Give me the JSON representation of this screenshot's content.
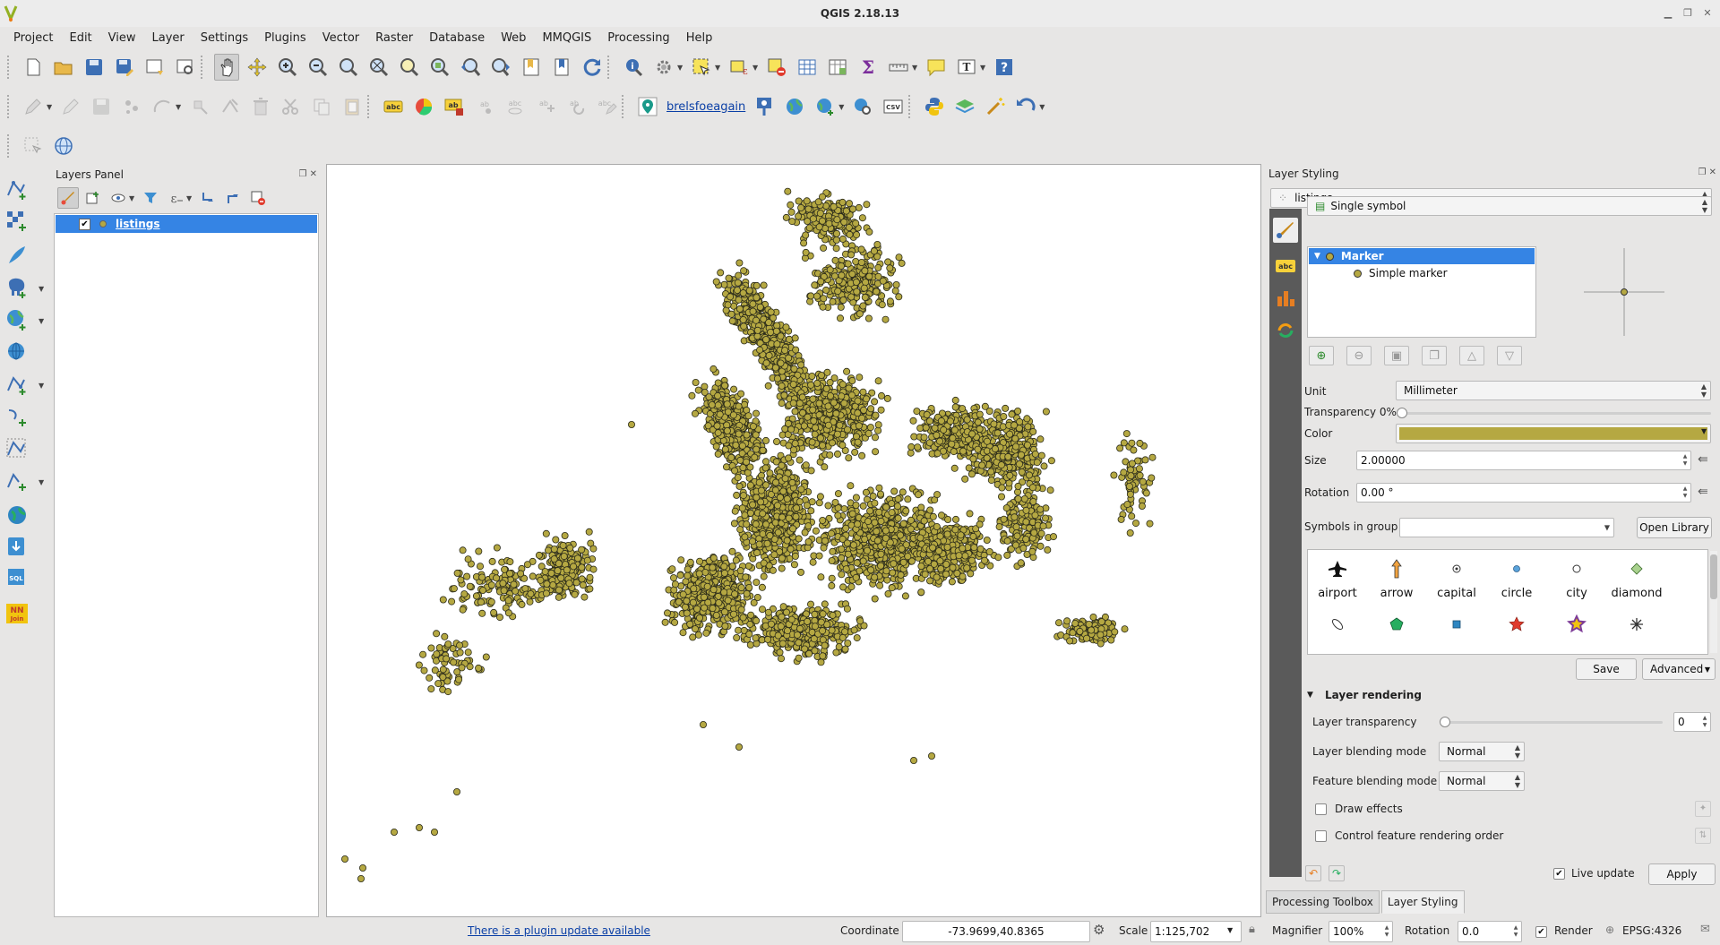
{
  "window": {
    "title": "QGIS 2.18.13"
  },
  "menu": [
    "Project",
    "Edit",
    "View",
    "Layer",
    "Settings",
    "Plugins",
    "Vector",
    "Raster",
    "Database",
    "Web",
    "MMQGIS",
    "Processing",
    "Help"
  ],
  "toolbar2": {
    "plugin_link": "brelsfoeagain"
  },
  "layers_panel": {
    "title": "Layers Panel",
    "layers": [
      {
        "name": "listings",
        "visible": true,
        "color": "#b5a842"
      }
    ]
  },
  "layer_styling": {
    "title": "Layer Styling",
    "layer": "listings",
    "renderer": "Single symbol",
    "tree": {
      "root": "Marker",
      "child": "Simple marker"
    },
    "unit_label": "Unit",
    "unit_value": "Millimeter",
    "transparency_label": "Transparency 0%",
    "color_label": "Color",
    "color_value": "#b5a842",
    "size_label": "Size",
    "size_value": "2.00000",
    "rotation_label": "Rotation",
    "rotation_value": "0.00 °",
    "symbols_group_label": "Symbols in group",
    "open_library": "Open Library",
    "symbols": [
      "airport",
      "arrow",
      "capital",
      "circle",
      "city",
      "diamond"
    ],
    "save": "Save",
    "advanced": "Advanced",
    "layer_rendering": "Layer rendering",
    "layer_transparency_label": "Layer transparency",
    "layer_transparency_value": "0",
    "layer_blending_label": "Layer blending mode",
    "layer_blending_value": "Normal",
    "feature_blending_label": "Feature blending mode",
    "feature_blending_value": "Normal",
    "draw_effects": "Draw effects",
    "control_order": "Control feature rendering order",
    "live_update": "Live update",
    "apply": "Apply"
  },
  "bottom_tabs": [
    "Processing Toolbox",
    "Layer Styling"
  ],
  "status": {
    "plugin_update": "There is a plugin update available",
    "coordinate_label": "Coordinate",
    "coordinate_value": "-73.9699,40.8365",
    "scale_label": "Scale",
    "scale_value": "1:125,702",
    "magnifier_label": "Magnifier",
    "magnifier_value": "100%",
    "rotation_label": "Rotation",
    "rotation_value": "0.0",
    "render_label": "Render",
    "crs": "EPSG:4326"
  }
}
